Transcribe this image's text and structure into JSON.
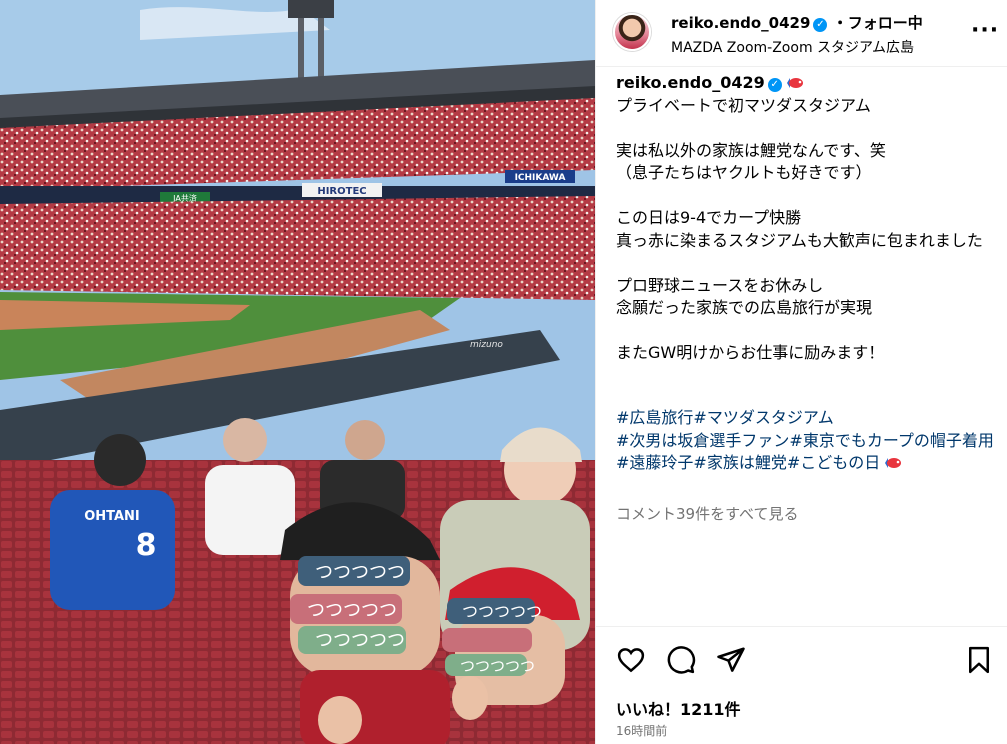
{
  "post": {
    "username": "reiko.endo_0429",
    "follow_status": "フォロー中",
    "separator": "・",
    "location": "MAZDA Zoom-Zoom スタジアム広島",
    "caption": "プライベートで初マツダスタジアム\n\n実は私以外の家族は鯉党なんです、笑\n（息子たちはヤクルトも好きです）\n\nこの日は9-4でカープ快勝\n真っ赤に染まるスタジアムも大歓声に包まれました\n\nプロ野球ニュースをお休みし\n念願だった家族での広島旅行が実現\n\nまたGW明けからお仕事に励みます！",
    "hashtags_line1": "#広島旅行#マツダスタジアム",
    "hashtags_line2": "#次男は坂倉選手ファン#東京でもカープの帽子着用",
    "hashtags_line3": "#遠藤玲子#家族は鯉党#こどもの日",
    "comments_link": "コメント39件をすべて見る",
    "likes": "いいね！1211件",
    "time_ago": "16時間前"
  },
  "photo": {
    "stadium_signs": [
      "HIROTEC",
      "ICHIKAWA",
      "JA共済",
      "mizuno"
    ],
    "jersey_name": "OHTANI",
    "jersey_number": "8",
    "face_stickers": [
      "つ",
      "つ",
      "つ",
      "つ",
      "つ"
    ]
  },
  "icons": {
    "verified": "verified-badge-icon",
    "more": "more-options-icon",
    "like": "heart-icon",
    "comment": "comment-icon",
    "share": "share-icon",
    "save": "bookmark-icon",
    "koinobori": "carp-streamer-icon"
  },
  "colors": {
    "link": "#00376b",
    "verified": "#0095f6",
    "muted": "#737373",
    "carp_red": "#c8102e"
  }
}
